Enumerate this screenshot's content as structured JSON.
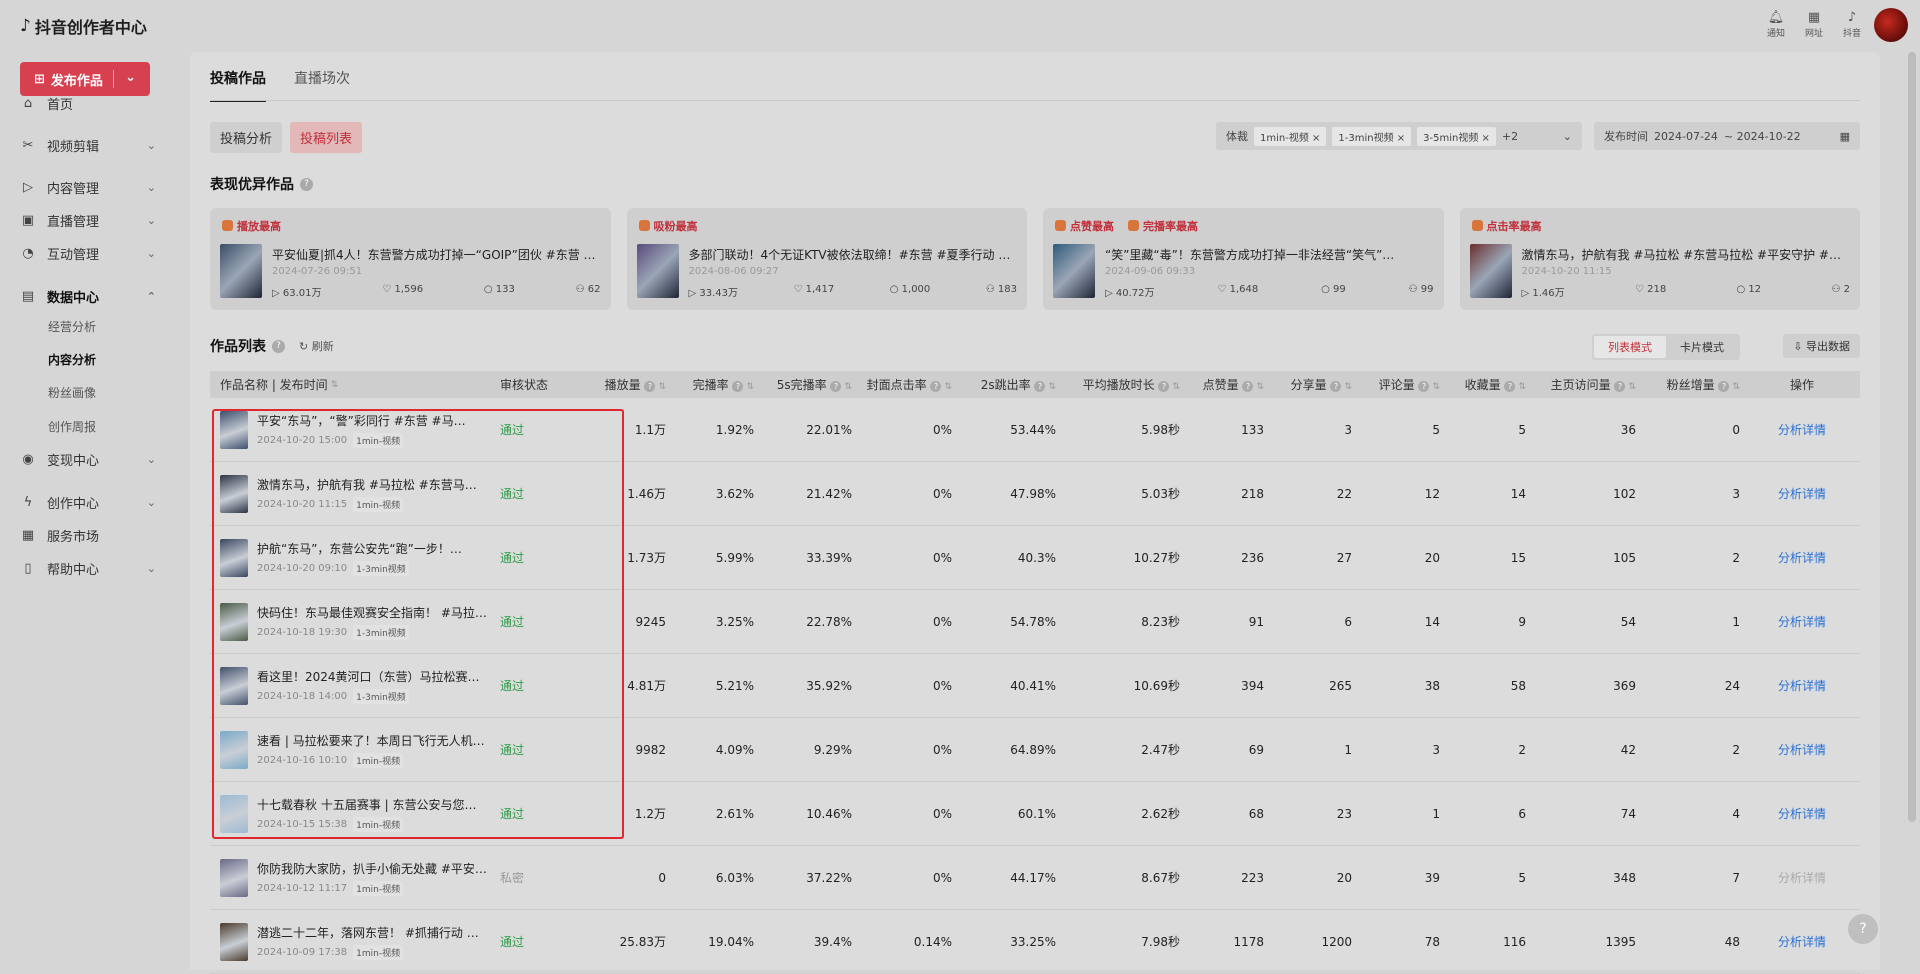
{
  "app": {
    "title": "抖音创作者中心"
  },
  "top_icons": [
    {
      "icon": "bell-icon",
      "label": "通知"
    },
    {
      "icon": "grid-icon",
      "label": "网址"
    },
    {
      "icon": "douyin-icon",
      "label": "抖音"
    }
  ],
  "sidebar": {
    "publish_label": "发布作品",
    "items": [
      {
        "label": "首页",
        "icon": "home-icon"
      },
      {
        "label": "视频剪辑",
        "icon": "scissors-icon"
      },
      {
        "label": "内容管理",
        "icon": "content-icon"
      },
      {
        "label": "直播管理",
        "icon": "live-icon"
      },
      {
        "label": "互动管理",
        "icon": "interact-icon"
      },
      {
        "label": "数据中心",
        "icon": "chart-icon"
      },
      {
        "label": "变现中心",
        "icon": "money-icon"
      },
      {
        "label": "创作中心",
        "icon": "create-icon"
      },
      {
        "label": "服务市场",
        "icon": "shop-icon"
      },
      {
        "label": "帮助中心",
        "icon": "book-icon"
      }
    ],
    "data_center_sub": [
      "经营分析",
      "内容分析",
      "粉丝画像",
      "创作周报"
    ]
  },
  "tabs": [
    "投稿作品",
    "直播场次"
  ],
  "subtabs": [
    "投稿分析",
    "投稿列表"
  ],
  "filters": {
    "genre_label": "体裁",
    "genre_chips": [
      "1min-视频",
      "1-3min视频",
      "3-5min视频"
    ],
    "genre_more": "+2",
    "date_label": "发布时间",
    "date_from": "2024-07-24",
    "date_to": "~ 2024-10-22"
  },
  "top_works": {
    "title": "表现优异作品",
    "cards": [
      {
        "tags": [
          "播放最高"
        ],
        "title": "平安“东马”，“警”彩同行 #东营 #马…",
        "date": "2024-10-20 15:00",
        "plays": "1.1万",
        "likes": "133",
        "comments": "5",
        "fans": "0"
      }
    ]
  },
  "cards": [
    {
      "tags": [
        "播放最高"
      ],
      "title": "平安仙夏|抓4人！东营警方成功打掉一“GOIP”团伙 #东营 …",
      "date": "2024-07-26 09:51",
      "plays": "63.01万",
      "likes": "1,596",
      "comments": "133",
      "fans": "62"
    },
    {
      "tags": [
        "吸粉最高"
      ],
      "title": "多部门联动！4个无证KTV被依法取缔！#东营 #夏季行动 #…",
      "date": "2024-08-06 09:27",
      "plays": "33.43万",
      "likes": "1,417",
      "comments": "1,000",
      "fans": "183"
    },
    {
      "tags": [
        "点赞最高",
        "完播率最高"
      ],
      "title": "“笑”里藏“毒”！东营警方成功打掉一非法经营“笑气”…",
      "date": "2024-09-06 09:33",
      "plays": "40.72万",
      "likes": "1,648",
      "comments": "99",
      "fans": "99"
    },
    {
      "tags": [
        "点击率最高"
      ],
      "title": "激情东马，护航有我 #马拉松 #东营马拉松 #平安守护 #东营…",
      "date": "2024-10-20 11:15",
      "plays": "1.46万",
      "likes": "218",
      "comments": "12",
      "fans": "2"
    }
  ],
  "list": {
    "title": "作品列表",
    "refresh": "刷新",
    "mode_list": "列表模式",
    "mode_card": "卡片模式",
    "export": "导出数据",
    "columns": [
      "作品名称 | 发布时间",
      "审核状态",
      "播放量",
      "完播率",
      "5s完播率",
      "封面点击率",
      "2s跳出率",
      "平均播放时长",
      "点赞量",
      "分享量",
      "评论量",
      "收藏量",
      "主页访问量",
      "粉丝增量",
      "操作"
    ],
    "rows": [
      {
        "title": "平安“东马”，“警”彩同行 #东营 #马…",
        "date": "2024-10-20 15:00",
        "dur": "1min-视频",
        "status": "通过",
        "plays": "1.1万",
        "finish": "1.92%",
        "finish5": "22.01%",
        "ctr": "0%",
        "bounce": "53.44%",
        "avg": "5.98秒",
        "likes": "133",
        "shares": "3",
        "comments": "5",
        "favs": "5",
        "visits": "36",
        "fans": "0",
        "action": "分析详情"
      },
      {
        "title": "激情东马，护航有我 #马拉松 #东营马拉…",
        "date": "2024-10-20 11:15",
        "dur": "1min-视频",
        "status": "通过",
        "plays": "1.46万",
        "finish": "3.62%",
        "finish5": "21.42%",
        "ctr": "0%",
        "bounce": "47.98%",
        "avg": "5.03秒",
        "likes": "218",
        "shares": "22",
        "comments": "12",
        "favs": "14",
        "visits": "102",
        "fans": "3",
        "action": "分析详情"
      },
      {
        "title": "护航“东马”，东营公安先“跑”一步！…",
        "date": "2024-10-20 09:10",
        "dur": "1-3min视频",
        "status": "通过",
        "plays": "1.73万",
        "finish": "5.99%",
        "finish5": "33.39%",
        "ctr": "0%",
        "bounce": "40.3%",
        "avg": "10.27秒",
        "likes": "236",
        "shares": "27",
        "comments": "20",
        "favs": "15",
        "visits": "105",
        "fans": "2",
        "action": "分析详情"
      },
      {
        "title": "快码住！东马最佳观赛安全指南！ #马拉…",
        "date": "2024-10-18 19:30",
        "dur": "1-3min视频",
        "status": "通过",
        "plays": "9245",
        "finish": "3.25%",
        "finish5": "22.78%",
        "ctr": "0%",
        "bounce": "54.78%",
        "avg": "8.23秒",
        "likes": "91",
        "shares": "6",
        "comments": "14",
        "favs": "9",
        "visits": "54",
        "fans": "1",
        "action": "分析详情"
      },
      {
        "title": "看这里！2024黄河口（东营）马拉松赛事…",
        "date": "2024-10-18 14:00",
        "dur": "1-3min视频",
        "status": "通过",
        "plays": "4.81万",
        "finish": "5.21%",
        "finish5": "35.92%",
        "ctr": "0%",
        "bounce": "40.41%",
        "avg": "10.69秒",
        "likes": "394",
        "shares": "265",
        "comments": "38",
        "favs": "58",
        "visits": "369",
        "fans": "24",
        "action": "分析详情"
      },
      {
        "title": "速看 | 马拉松要来了！本周日飞行无人机…",
        "date": "2024-10-16 10:10",
        "dur": "1min-视频",
        "status": "通过",
        "plays": "9982",
        "finish": "4.09%",
        "finish5": "9.29%",
        "ctr": "0%",
        "bounce": "64.89%",
        "avg": "2.47秒",
        "likes": "69",
        "shares": "1",
        "comments": "3",
        "favs": "2",
        "visits": "42",
        "fans": "2",
        "action": "分析详情"
      },
      {
        "title": "十七载春秋 十五届赛事 | 东营公安与您携…",
        "date": "2024-10-15 15:38",
        "dur": "1min-视频",
        "status": "通过",
        "plays": "1.2万",
        "finish": "2.61%",
        "finish5": "10.46%",
        "ctr": "0%",
        "bounce": "60.1%",
        "avg": "2.62秒",
        "likes": "68",
        "shares": "23",
        "comments": "1",
        "favs": "6",
        "visits": "74",
        "fans": "4",
        "action": "分析详情"
      },
      {
        "title": "你防我防大家防，扒手小偷无处藏 #平安…",
        "date": "2024-10-12 11:17",
        "dur": "1min-视频",
        "status": "私密",
        "plays": "0",
        "finish": "6.03%",
        "finish5": "37.22%",
        "ctr": "0%",
        "bounce": "44.17%",
        "avg": "8.67秒",
        "likes": "223",
        "shares": "20",
        "comments": "39",
        "favs": "5",
        "visits": "348",
        "fans": "7",
        "action": "分析详情"
      },
      {
        "title": "潜逃二十二年，落网东营！ #抓捕行动 #…",
        "date": "2024-10-09 17:38",
        "dur": "1min-视频",
        "status": "通过",
        "plays": "25.83万",
        "finish": "19.04%",
        "finish5": "39.4%",
        "ctr": "0.14%",
        "bounce": "33.25%",
        "avg": "7.98秒",
        "likes": "1178",
        "shares": "1200",
        "comments": "78",
        "favs": "116",
        "visits": "1395",
        "fans": "48",
        "action": "分析详情"
      }
    ]
  },
  "colors": {
    "accent": "#d7404e",
    "pass": "#2e9b47",
    "link": "#2a6fd8",
    "highlight": "#e0282e"
  }
}
